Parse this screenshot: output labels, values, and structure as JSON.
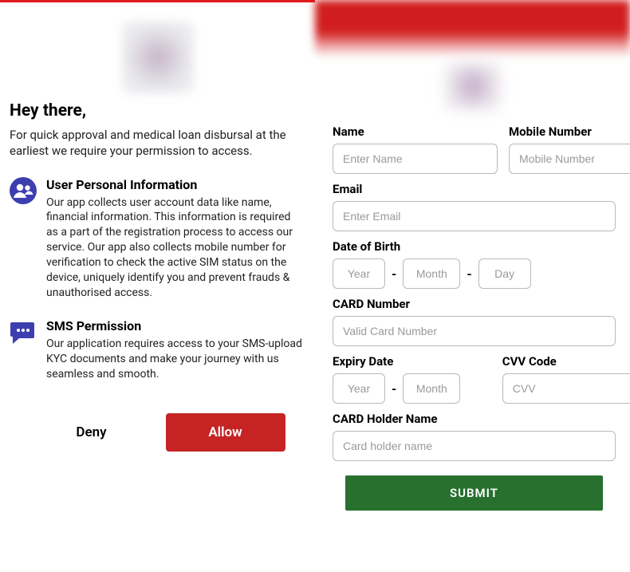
{
  "left": {
    "greeting": "Hey there,",
    "subhead": "For quick approval and medical loan disbursal at the earliest we require your permission to access.",
    "perm1": {
      "title": "User Personal Information",
      "body": "Our app collects user account data like name, financial information. This information is required as a part of the registration process to access our service. Our app also collects mobile number for verification to check the active SIM status on the device, uniquely identify you and prevent frauds & unauthorised access."
    },
    "perm2": {
      "title": "SMS Permission",
      "body": "Our application requires access to your SMS-upload KYC documents and make your journey with us seamless and smooth."
    },
    "deny_label": "Deny",
    "allow_label": "Allow"
  },
  "right": {
    "name_label": "Name",
    "name_ph": "Enter Name",
    "mobile_label": "Mobile Number",
    "mobile_ph": "Mobile Number",
    "email_label": "Email",
    "email_ph": "Enter Email",
    "dob_label": "Date of Birth",
    "dob_year_ph": "Year",
    "dob_month_ph": "Month",
    "dob_day_ph": "Day",
    "card_label": "CARD Number",
    "card_ph": "Valid Card Number",
    "expiry_label": "Expiry Date",
    "expiry_year_ph": "Year",
    "expiry_month_ph": "Month",
    "cvv_label": "CVV Code",
    "cvv_ph": "CVV",
    "holder_label": "CARD Holder Name",
    "holder_ph": "Card holder name",
    "submit_label": "SUBMIT"
  },
  "colors": {
    "brand_red": "#c62424",
    "submit_green": "#27702e",
    "icon_purple": "#3d3fb0"
  }
}
